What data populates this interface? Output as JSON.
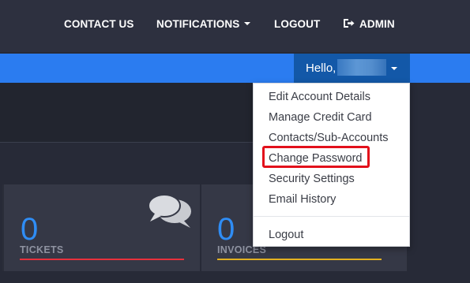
{
  "nav": {
    "contact_us": "CONTACT US",
    "notifications": "NOTIFICATIONS",
    "logout": "LOGOUT",
    "admin": "ADMIN"
  },
  "user_menu": {
    "greeting": "Hello,"
  },
  "dropdown": {
    "items": [
      "Edit Account Details",
      "Manage Credit Card",
      "Contacts/Sub-Accounts",
      "Change Password",
      "Security Settings",
      "Email History",
      "Logout"
    ],
    "highlighted_item": "Change Password"
  },
  "panels": [
    {
      "count": "0",
      "label": "TICKETS",
      "accent": "#e8313c"
    },
    {
      "count": "0",
      "label": "INVOICES",
      "accent": "#e2b021"
    }
  ],
  "colors": {
    "nav_bg": "#2d303f",
    "blue_bar": "#2b7cf0",
    "user_button": "#1358a8",
    "highlight_border": "#e2101b"
  },
  "icons": {
    "admin": "sign-out-arrow-icon",
    "tickets": "chat-bubbles-icon"
  }
}
